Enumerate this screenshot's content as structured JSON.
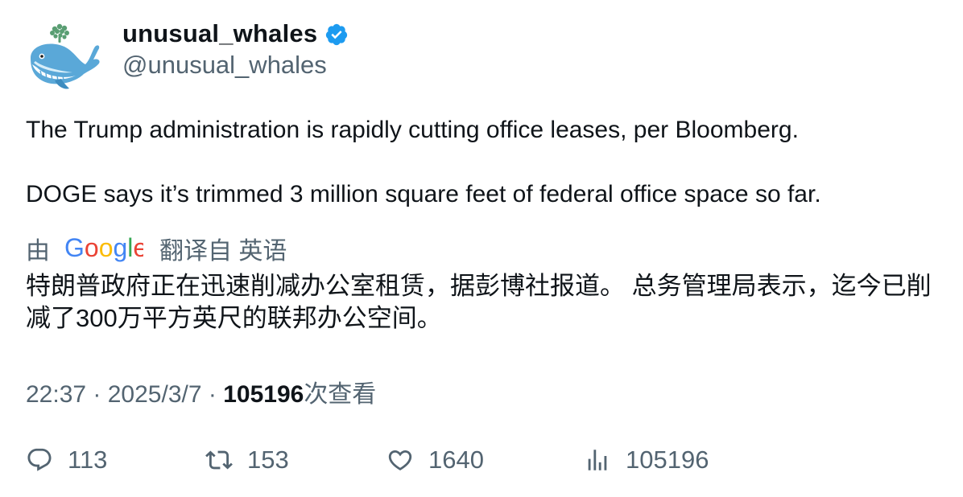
{
  "author": {
    "display_name": "unusual_whales",
    "handle": "@unusual_whales",
    "avatar_icon": "whale-avatar-icon",
    "verified_icon": "verified-badge-icon"
  },
  "tweet": {
    "text_line_1": "The Trump administration is rapidly cutting office leases, per Bloomberg.",
    "text_line_2": "DOGE says it’s trimmed 3 million square feet of federal office space so far."
  },
  "translation": {
    "by_label": "由",
    "provider": "Google",
    "translated_from_label": "翻译自 英语",
    "translated_text": "特朗普政府正在迅速削减办公室租赁，据彭博社报道。 总务管理局表示，迄今已削减了300万平方英尺的联邦办公空间。"
  },
  "meta": {
    "time": "22:37",
    "separator": " · ",
    "date": "2025/3/7",
    "views_count": "105196",
    "views_label": "次查看"
  },
  "actions": {
    "replies": "113",
    "retweets": "153",
    "likes": "1640",
    "views": "105196"
  },
  "colors": {
    "text_primary": "#0f1419",
    "text_secondary": "#536471",
    "verified_blue": "#1d9bf0",
    "google_blue": "#4285F4",
    "google_red": "#EA4335",
    "google_yellow": "#FBBC05",
    "google_green": "#34A853"
  }
}
